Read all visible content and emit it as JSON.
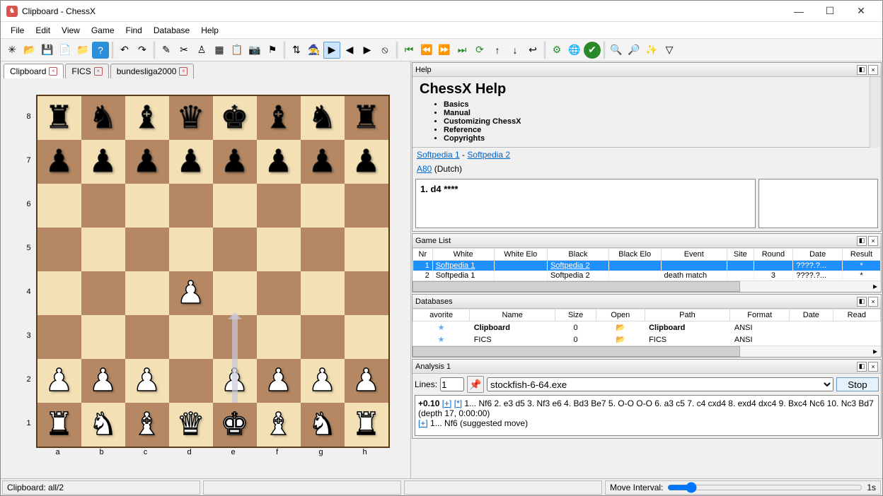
{
  "window": {
    "title": "Clipboard - ChessX"
  },
  "menu": [
    "File",
    "Edit",
    "View",
    "Game",
    "Find",
    "Database",
    "Help"
  ],
  "tabs": [
    {
      "label": "Clipboard"
    },
    {
      "label": "FICS"
    },
    {
      "label": "bundesliga2000"
    }
  ],
  "board": {
    "ranks": [
      "8",
      "7",
      "6",
      "5",
      "4",
      "3",
      "2",
      "1"
    ],
    "files": [
      "a",
      "b",
      "c",
      "d",
      "e",
      "f",
      "g",
      "h"
    ],
    "position": [
      [
        "r",
        "n",
        "b",
        "q",
        "k",
        "b",
        "n",
        "r"
      ],
      [
        "p",
        "p",
        "p",
        "p",
        "p",
        "p",
        "p",
        "p"
      ],
      [
        "",
        "",
        "",
        "",
        "",
        "",
        "",
        ""
      ],
      [
        "",
        "",
        "",
        "",
        "",
        "",
        "",
        ""
      ],
      [
        "",
        "",
        "",
        "P",
        "",
        "",
        "",
        ""
      ],
      [
        "",
        "",
        "",
        "",
        "",
        "",
        "",
        ""
      ],
      [
        "P",
        "P",
        "P",
        "",
        "P",
        "P",
        "P",
        "P"
      ],
      [
        "R",
        "N",
        "B",
        "Q",
        "K",
        "B",
        "N",
        "R"
      ]
    ],
    "arrow": {
      "from": "e2",
      "to": "e4"
    }
  },
  "help": {
    "title": "Help",
    "heading": "ChessX Help",
    "topics": [
      "Basics",
      "Manual",
      "Customizing ChessX",
      "Reference",
      "Copyrights"
    ]
  },
  "links": {
    "a": "Softpedia 1",
    "sep": " - ",
    "b": "Softpedia 2"
  },
  "eco": {
    "code": "A80",
    "name": "(Dutch)"
  },
  "notation": {
    "text": "1. d4 ****"
  },
  "gamelist": {
    "title": "Game List",
    "cols": [
      "Nr",
      "White",
      "White Elo",
      "Black",
      "Black Elo",
      "Event",
      "Site",
      "Round",
      "Date",
      "Result"
    ],
    "rows": [
      {
        "nr": "1",
        "white": "Softpedia 1",
        "welo": "",
        "black": "Softpedia 2",
        "belo": "",
        "event": "",
        "site": "",
        "round": "",
        "date": "????.?...",
        "result": "*",
        "sel": true
      },
      {
        "nr": "2",
        "white": "Softpedia 1",
        "welo": "",
        "black": "Softpedia 2",
        "belo": "",
        "event": "death match",
        "site": "",
        "round": "3",
        "date": "????.?...",
        "result": "*",
        "sel": false
      }
    ]
  },
  "databases": {
    "title": "Databases",
    "cols": [
      "avorite",
      "Name",
      "Size",
      "Open",
      "Path",
      "Format",
      "Date",
      "Read"
    ],
    "rows": [
      {
        "fav": true,
        "name": "Clipboard",
        "size": "0",
        "open": true,
        "path": "Clipboard",
        "format": "ANSI",
        "date": "",
        "bold": true
      },
      {
        "fav": true,
        "name": "FICS",
        "size": "0",
        "open": true,
        "path": "FICS",
        "format": "ANSI",
        "date": "",
        "bold": false
      }
    ]
  },
  "analysis": {
    "title": "Analysis 1",
    "lines_label": "Lines:",
    "lines_value": "1",
    "engine": "stockfish-6-64.exe",
    "stop": "Stop",
    "score": "+0.10",
    "bracket1": "[+]",
    "bracket2": "[*]",
    "line1": " 1... Nf6 2. e3 d5 3. Nf3 e6 4. Bd3 Be7 5. O-O O-O 6. a3 c5 7. c4 cxd4 8. exd4 dxc4 9. Bxc4 Nc6 10. Nc3 Bd7 (depth 17, 0:00:00)",
    "bracket3": "[+]",
    "line2": " 1... Nf6 (suggested move)"
  },
  "status": {
    "left": "Clipboard: all/2",
    "interval_label": "Move Interval:",
    "interval_value": "1s"
  }
}
